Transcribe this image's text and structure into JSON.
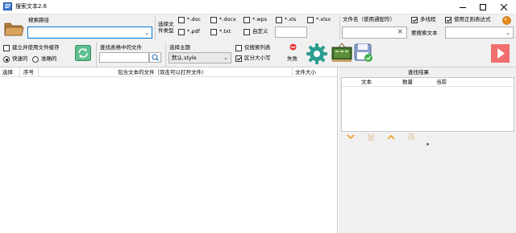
{
  "window": {
    "title": "搜索文本2.6",
    "minimize_icon": "minimize-icon",
    "maximize_icon": "maximize-icon",
    "close_icon": "close-icon"
  },
  "search_path": {
    "label": "搜索路径",
    "value": "",
    "folder_icon": "folder-icon"
  },
  "file_types": {
    "label": "选择文件类型",
    "options": [
      {
        "label": "*.doc",
        "checked": false
      },
      {
        "label": "*.docx",
        "checked": false
      },
      {
        "label": "*.wps",
        "checked": false
      },
      {
        "label": "*.xls",
        "checked": false
      },
      {
        "label": "*.xlsx",
        "checked": false
      },
      {
        "label": "*.pdf",
        "checked": false
      },
      {
        "label": "*.txt",
        "checked": false
      },
      {
        "label": "自定义",
        "checked": false
      }
    ],
    "custom_value": ""
  },
  "filename": {
    "label": "文件名（使用通配符）",
    "value": ""
  },
  "multithread": {
    "label": "多线程",
    "checked": true
  },
  "regex": {
    "label": "使用正则表达式",
    "checked": true
  },
  "search_text": {
    "label": "要搜索文本",
    "value": ""
  },
  "cache": {
    "label": "建立并使用文件缓存",
    "checked": false
  },
  "speed": {
    "fast_label": "快速的",
    "accurate_label": "准确的",
    "selected": "fast"
  },
  "table_search": {
    "label": "查找表格中的文件",
    "value": ""
  },
  "theme": {
    "label": "选择主题",
    "value": "默认.style"
  },
  "list_only": {
    "label": "仅搜索列表",
    "checked": false
  },
  "case_sensitive": {
    "label": "区分大小写",
    "checked": true
  },
  "fail_button": {
    "label": "失败"
  },
  "file_table": {
    "columns": [
      "选择",
      "序号",
      "包含文本的文件（双击可以打开文件）",
      "文件大小"
    ]
  },
  "results": {
    "title": "查找结果",
    "columns": [
      "文本",
      "数量",
      "当前"
    ]
  },
  "colors": {
    "accent_green": "#2a9d8f",
    "play_red": "#f26d6d",
    "arrow_orange": "#f0a020",
    "focus_blue": "#0078d7"
  }
}
